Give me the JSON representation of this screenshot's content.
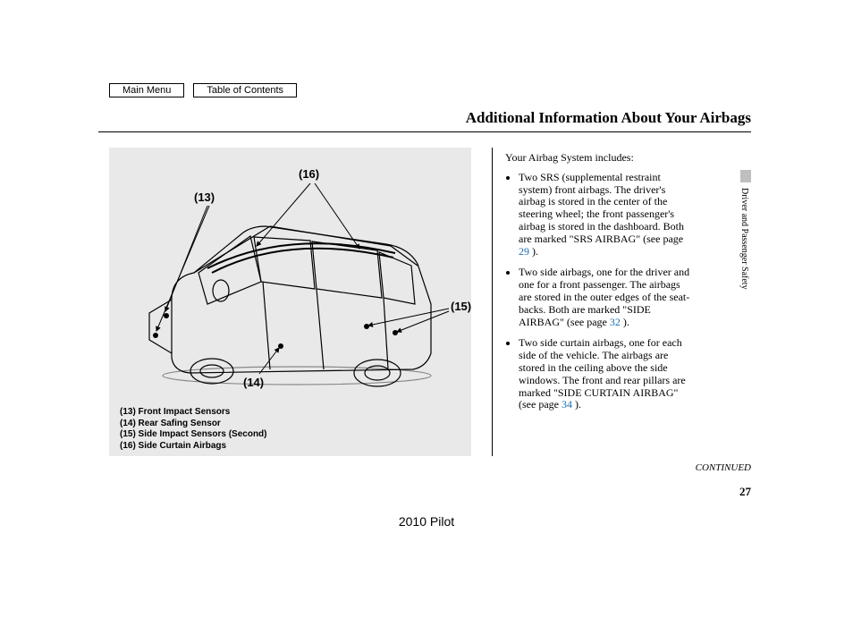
{
  "nav": {
    "main_menu": "Main Menu",
    "toc": "Table of Contents"
  },
  "title": "Additional Information About Your Airbags",
  "diagram": {
    "callouts": {
      "c13": "(13)",
      "c14": "(14)",
      "c15": "(15)",
      "c16": "(16)"
    },
    "legend": {
      "l13": "(13) Front Impact Sensors",
      "l14": "(14) Rear Safing Sensor",
      "l15": "(15) Side Impact Sensors (Second)",
      "l16": "(16) Side Curtain Airbags"
    }
  },
  "body": {
    "intro": "Your Airbag System includes:",
    "items": {
      "a1": "Two SRS (supplemental restraint system) front airbags. The driver's airbag is stored in the center of the steering wheel; the front passenger's airbag is stored in the dashboard. Both are marked \"SRS AIRBAG\" (see page ",
      "a1_pg": "29",
      "a1_end": " ).",
      "a2": "Two side airbags, one for the driver and one for a front passenger. The airbags are stored in the outer edges of the seat-backs. Both are marked \"SIDE AIRBAG\" (see page ",
      "a2_pg": "32",
      "a2_end": " ).",
      "a3": "Two side curtain airbags, one for each side of the vehicle. The airbags are stored in the ceiling above the side windows. The front and rear pillars are marked \"SIDE CURTAIN AIRBAG\" (see page ",
      "a3_pg": "34",
      "a3_end": " )."
    }
  },
  "side_label": "Driver and Passenger Safety",
  "continued": "CONTINUED",
  "page_number": "27",
  "footer_model": "2010 Pilot"
}
